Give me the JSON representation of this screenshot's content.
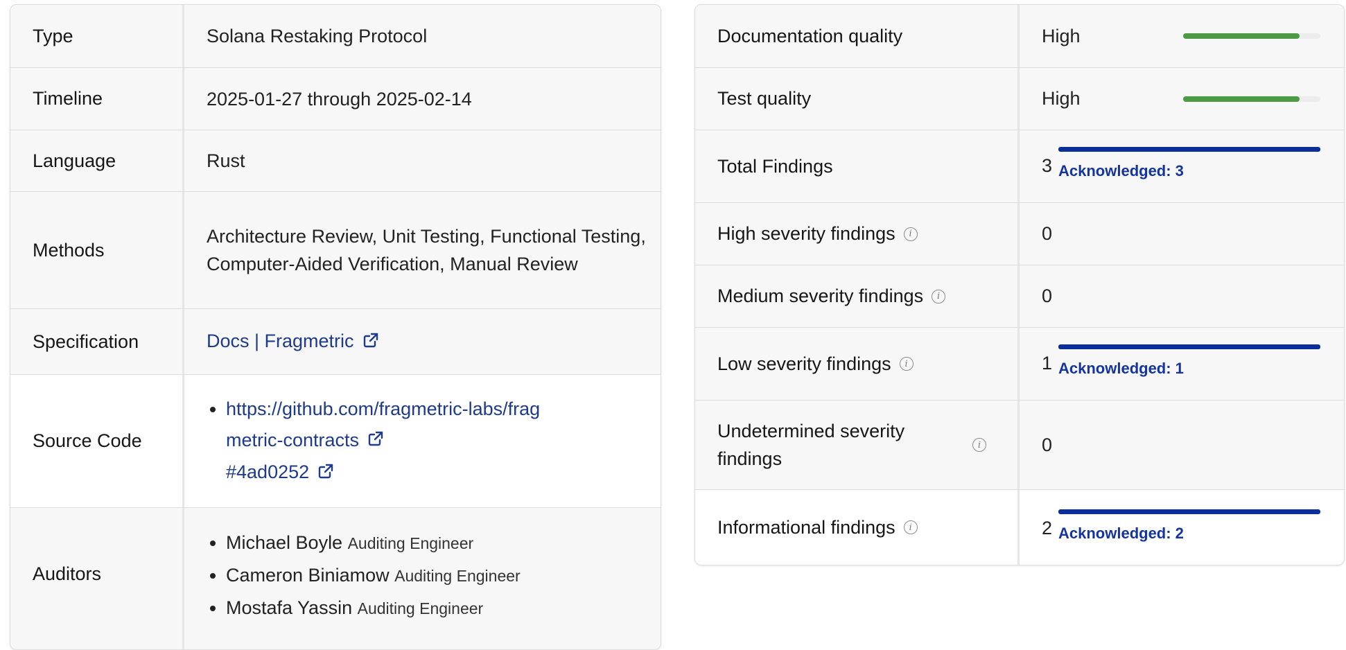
{
  "overview": {
    "type": {
      "label": "Type",
      "value": "Solana Restaking Protocol"
    },
    "timeline": {
      "label": "Timeline",
      "value": "2025-01-27 through 2025-02-14"
    },
    "language": {
      "label": "Language",
      "value": "Rust"
    },
    "methods": {
      "label": "Methods",
      "value": "Architecture Review, Unit Testing, Functional Testing, Computer-Aided Verification, Manual Review"
    },
    "specification": {
      "label": "Specification",
      "link_text": "Docs | Fragmetric",
      "icon": "external-link-icon"
    },
    "source_code": {
      "label": "Source Code",
      "repo_link": "https://github.com/fragmetric-labs/fragmetric-contracts",
      "commit_link": "#4ad0252",
      "icon": "external-link-icon"
    },
    "auditors": {
      "label": "Auditors",
      "items": [
        {
          "name": "Michael Boyle",
          "role": "Auditing Engineer"
        },
        {
          "name": "Cameron Biniamow",
          "role": "Auditing Engineer"
        },
        {
          "name": "Mostafa Yassin",
          "role": "Auditing Engineer"
        }
      ]
    }
  },
  "summary": {
    "documentation_quality": {
      "label": "Documentation quality",
      "value": "High",
      "level": 0.85
    },
    "test_quality": {
      "label": "Test quality",
      "value": "High",
      "level": 0.85
    },
    "total_findings": {
      "label": "Total Findings",
      "count": "3",
      "status": "Acknowledged: 3"
    },
    "high_severity": {
      "label": "High severity findings",
      "count": "0",
      "icon": "info-icon"
    },
    "medium_severity": {
      "label": "Medium severity findings",
      "count": "0",
      "icon": "info-icon"
    },
    "low_severity": {
      "label": "Low severity findings",
      "count": "1",
      "status": "Acknowledged: 1",
      "icon": "info-icon"
    },
    "undetermined_severity": {
      "label": "Undetermined severity findings",
      "count": "0",
      "icon": "info-icon"
    },
    "informational": {
      "label": "Informational findings",
      "count": "2",
      "status": "Acknowledged: 2",
      "icon": "info-icon"
    }
  },
  "colors": {
    "quality_bar": "#4c9a43",
    "acknowledged": "#0b2f9a",
    "link": "#1e3a8a"
  }
}
